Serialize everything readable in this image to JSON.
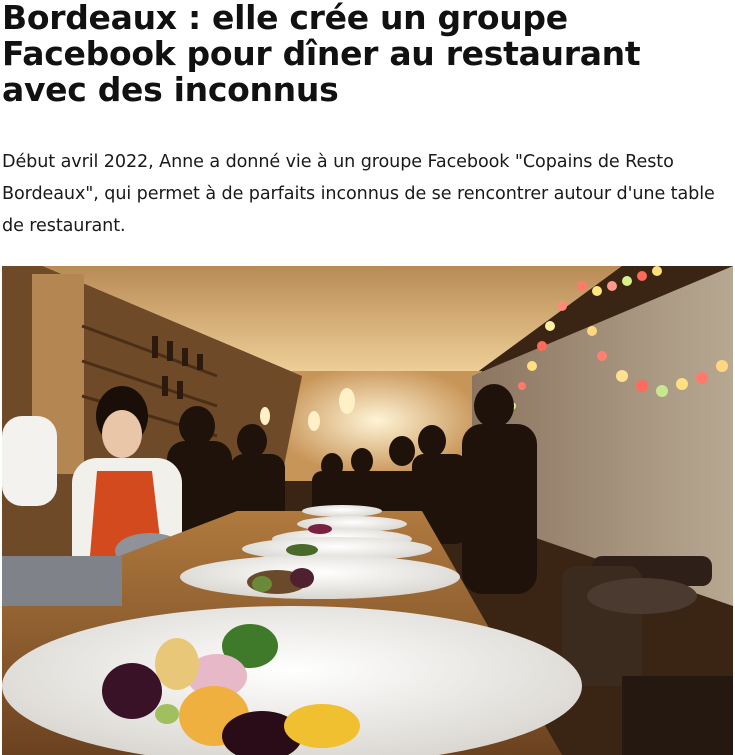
{
  "article": {
    "headline": "Bordeaux : elle crée un groupe Facebook pour dîner au restaurant avec des inconnus",
    "lead": "Début avril 2022, Anne a donné vie à un groupe Facebook \"Copains de Resto Bordeaux\", qui permet à de parfaits inconnus de se rencontrer autour d'une table de restaurant."
  },
  "photo": {
    "subject": "restaurant dinner scene with plated dishes on a long counter",
    "colors": {
      "wall_warm": "#c99a5c",
      "ceiling": "#d8ad70",
      "wood": "#b07a3e",
      "shadow": "#1e120a",
      "plate": "#f2f0ec",
      "apron": "#d24a1e"
    }
  }
}
